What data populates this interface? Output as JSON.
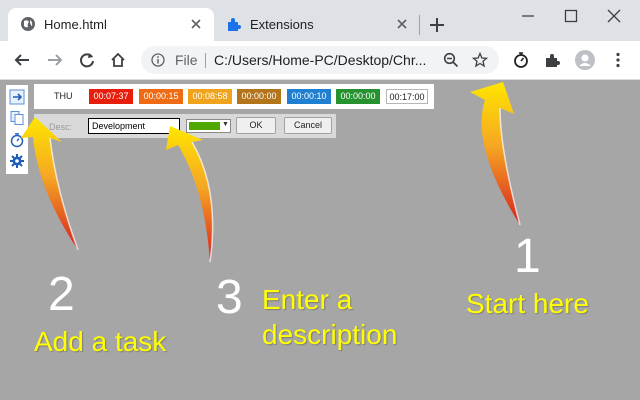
{
  "browser": {
    "tabs": [
      {
        "title": "Home.html",
        "active": true
      },
      {
        "title": "Extensions",
        "active": false
      }
    ],
    "url_scheme_label": "File",
    "url": "C:/Users/Home-PC/Desktop/Chr..."
  },
  "extension": {
    "day": "THU",
    "timers": [
      {
        "value": "00:07:37",
        "color": "#e81e0c"
      },
      {
        "value": "00:00:15",
        "color": "#ee6a13"
      },
      {
        "value": "00:08:58",
        "color": "#f0a31d"
      },
      {
        "value": "00:00:00",
        "color": "#b27519"
      },
      {
        "value": "00:00:10",
        "color": "#1f7fd0"
      },
      {
        "value": "00:00:00",
        "color": "#26922f"
      }
    ],
    "total": "00:17:00",
    "desc_label": "Desc:",
    "desc_value": "Development",
    "selected_color": "#4ea800",
    "ok_label": "OK",
    "cancel_label": "Cancel"
  },
  "annotations": {
    "step1": {
      "number": "1",
      "text": "Start here"
    },
    "step2": {
      "number": "2",
      "text": "Add a task"
    },
    "step3": {
      "number": "3",
      "text_line1": "Enter a",
      "text_line2": "description"
    }
  },
  "accent_colors": {
    "annotation_text": "#ffff00",
    "arrow_top": "#ffe600",
    "arrow_bottom": "#e02020"
  }
}
